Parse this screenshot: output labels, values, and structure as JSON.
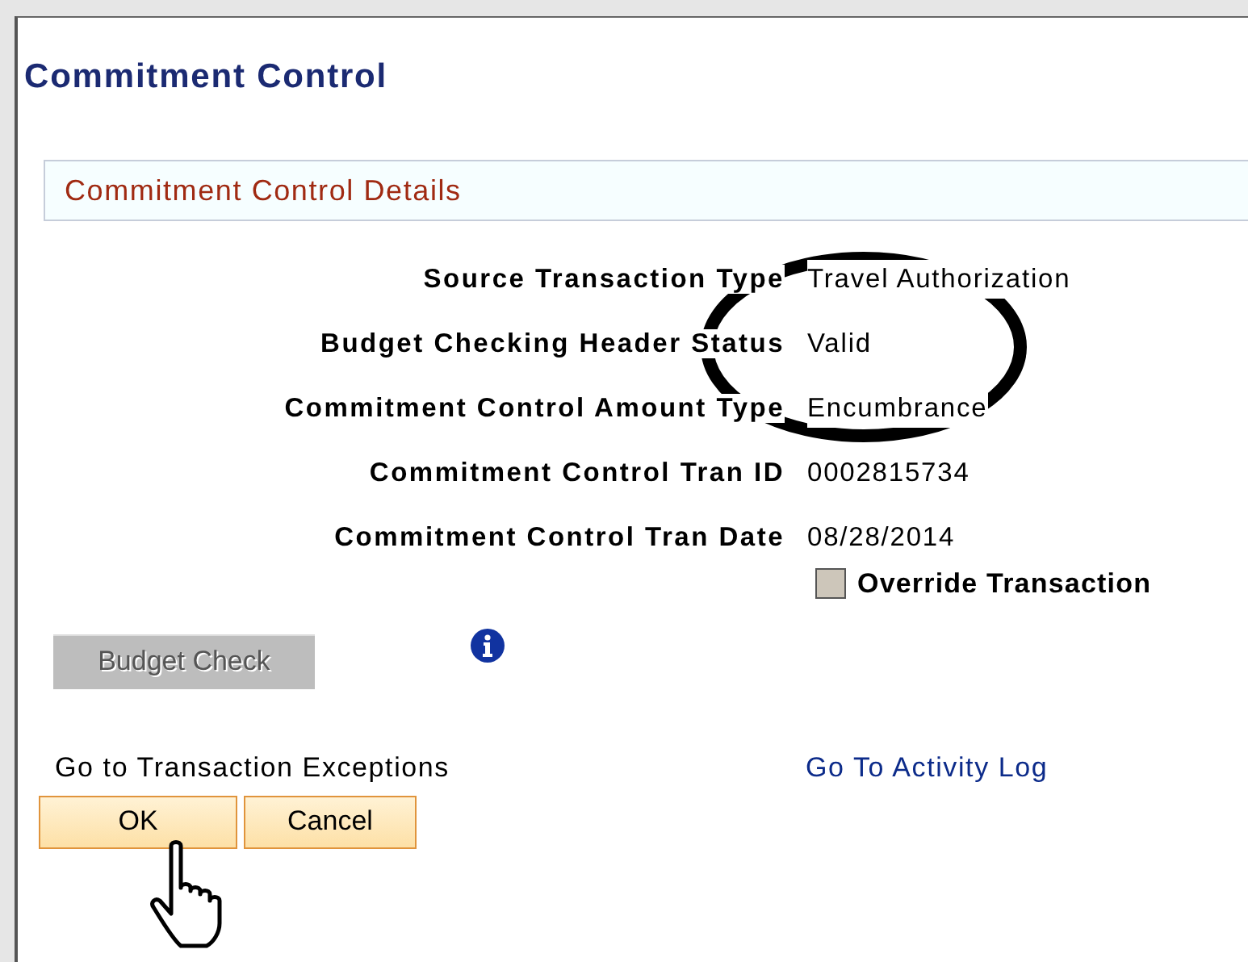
{
  "page": {
    "title": "Commitment Control"
  },
  "section": {
    "title": "Commitment Control Details"
  },
  "fields": [
    {
      "label": "Source Transaction Type",
      "value": "Travel Authorization"
    },
    {
      "label": "Budget Checking Header Status",
      "value": "Valid"
    },
    {
      "label": "Commitment Control Amount Type",
      "value": "Encumbrance"
    },
    {
      "label": "Commitment Control Tran ID",
      "value": "0002815734"
    },
    {
      "label": "Commitment Control Tran Date",
      "value": "08/28/2014"
    }
  ],
  "override": {
    "label": "Override Transaction",
    "checked": false
  },
  "budget_check": {
    "label": "Budget Check",
    "disabled": true
  },
  "links": [
    {
      "label": "Go to Transaction Exceptions",
      "kind": "plain"
    },
    {
      "label": "Go To Activity Log",
      "kind": "link"
    }
  ],
  "buttons": [
    "OK",
    "Cancel"
  ]
}
